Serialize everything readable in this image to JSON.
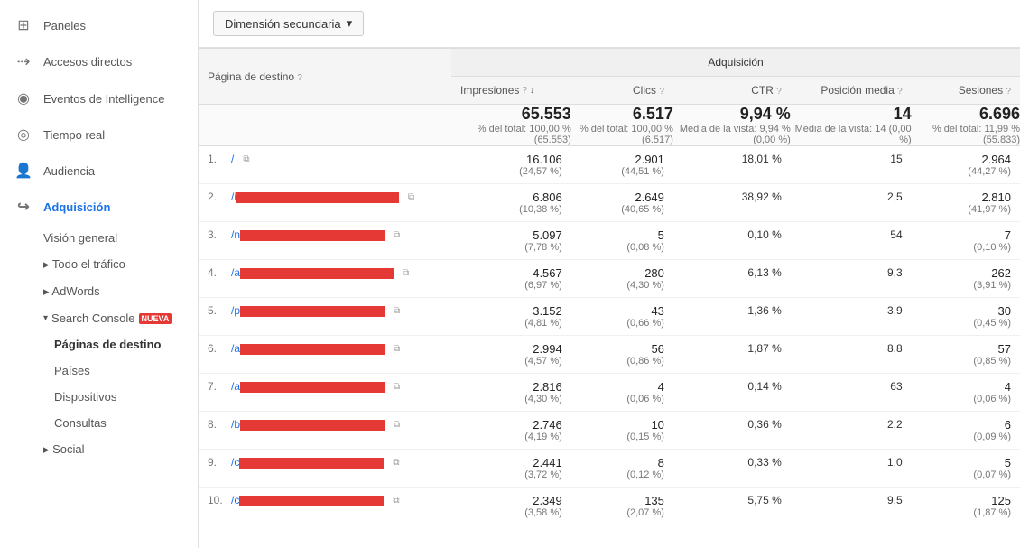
{
  "sidebar": {
    "items": [
      {
        "id": "paneles",
        "label": "Paneles",
        "icon": "⊞"
      },
      {
        "id": "accesos-directos",
        "label": "Accesos directos",
        "icon": "→"
      },
      {
        "id": "eventos-intelligence",
        "label": "Eventos de Intelligence",
        "icon": "○"
      },
      {
        "id": "tiempo-real",
        "label": "Tiempo real",
        "icon": "○"
      },
      {
        "id": "audiencia",
        "label": "Audiencia",
        "icon": "👤"
      },
      {
        "id": "adquisicion",
        "label": "Adquisición",
        "icon": "→",
        "active": true
      }
    ],
    "adquisicion_sub": [
      {
        "id": "vision-general",
        "label": "Visión general"
      },
      {
        "id": "todo-trafico",
        "label": "▸ Todo el tráfico",
        "arrow": true
      },
      {
        "id": "adwords",
        "label": "▸ AdWords",
        "arrow": true
      },
      {
        "id": "search-console",
        "label": "Search Console",
        "nueva": "NUEVA",
        "expanded": true
      },
      {
        "id": "paginas-destino",
        "label": "Páginas de destino",
        "active": true,
        "bold": true
      },
      {
        "id": "paises",
        "label": "Países"
      },
      {
        "id": "dispositivos",
        "label": "Dispositivos"
      },
      {
        "id": "consultas",
        "label": "Consultas"
      },
      {
        "id": "social",
        "label": "▸ Social",
        "arrow": true
      }
    ]
  },
  "toolbar": {
    "secondary_dimension_label": "Dimensión secundaria",
    "dropdown_icon": "▾"
  },
  "table": {
    "columns": {
      "page": {
        "label": "Página de destino",
        "help": "?"
      },
      "adquisicion_group": "Adquisición",
      "impresiones": {
        "label": "Impresiones",
        "help": "?",
        "sorted": true
      },
      "clics": {
        "label": "Clics",
        "help": "?"
      },
      "ctr": {
        "label": "CTR",
        "help": "?"
      },
      "posicion_media": {
        "label": "Posición media",
        "help": "?"
      },
      "sesiones": {
        "label": "Sesiones",
        "help": "?"
      }
    },
    "totals": {
      "impresiones": "65.553",
      "impresiones_sub": "% del total: 100,00 % (65.553)",
      "clics": "6.517",
      "clics_sub": "% del total: 100,00 % (6.517)",
      "ctr": "9,94 %",
      "ctr_sub": "Media de la vista: 9,94 % (0,00 %)",
      "posicion_media": "14",
      "posicion_media_sub": "Media de la vista: 14 (0,00 %)",
      "sesiones": "6.696",
      "sesiones_sub": "% del total: 11,99 % (55.833)"
    },
    "rows": [
      {
        "num": "1.",
        "page": "/",
        "redacted": false,
        "impresiones": "16.106",
        "impresiones_pct": "(24,57 %)",
        "clics": "2.901",
        "clics_pct": "(44,51 %)",
        "ctr": "18,01 %",
        "posicion": "15",
        "sesiones": "2.964",
        "sesiones_pct": "(44,27 %)"
      },
      {
        "num": "2.",
        "page": "/i",
        "redacted": true,
        "impresiones": "6.806",
        "impresiones_pct": "(10,38 %)",
        "clics": "2.649",
        "clics_pct": "(40,65 %)",
        "ctr": "38,92 %",
        "posicion": "2,5",
        "sesiones": "2.810",
        "sesiones_pct": "(41,97 %)"
      },
      {
        "num": "3.",
        "page": "/n",
        "redacted": true,
        "impresiones": "5.097",
        "impresiones_pct": "(7,78 %)",
        "clics": "5",
        "clics_pct": "(0,08 %)",
        "ctr": "0,10 %",
        "posicion": "54",
        "sesiones": "7",
        "sesiones_pct": "(0,10 %)"
      },
      {
        "num": "4.",
        "page": "/a",
        "redacted": true,
        "impresiones": "4.567",
        "impresiones_pct": "(6,97 %)",
        "clics": "280",
        "clics_pct": "(4,30 %)",
        "ctr": "6,13 %",
        "posicion": "9,3",
        "sesiones": "262",
        "sesiones_pct": "(3,91 %)"
      },
      {
        "num": "5.",
        "page": "/p",
        "redacted": true,
        "impresiones": "3.152",
        "impresiones_pct": "(4,81 %)",
        "clics": "43",
        "clics_pct": "(0,66 %)",
        "ctr": "1,36 %",
        "posicion": "3,9",
        "sesiones": "30",
        "sesiones_pct": "(0,45 %)"
      },
      {
        "num": "6.",
        "page": "/a",
        "redacted": true,
        "impresiones": "2.994",
        "impresiones_pct": "(4,57 %)",
        "clics": "56",
        "clics_pct": "(0,86 %)",
        "ctr": "1,87 %",
        "posicion": "8,8",
        "sesiones": "57",
        "sesiones_pct": "(0,85 %)"
      },
      {
        "num": "7.",
        "page": "/a",
        "redacted": true,
        "impresiones": "2.816",
        "impresiones_pct": "(4,30 %)",
        "clics": "4",
        "clics_pct": "(0,06 %)",
        "ctr": "0,14 %",
        "posicion": "63",
        "sesiones": "4",
        "sesiones_pct": "(0,06 %)"
      },
      {
        "num": "8.",
        "page": "/b",
        "redacted": true,
        "impresiones": "2.746",
        "impresiones_pct": "(4,19 %)",
        "clics": "10",
        "clics_pct": "(0,15 %)",
        "ctr": "0,36 %",
        "posicion": "2,2",
        "sesiones": "6",
        "sesiones_pct": "(0,09 %)"
      },
      {
        "num": "9.",
        "page": "/c",
        "redacted": true,
        "impresiones": "2.441",
        "impresiones_pct": "(3,72 %)",
        "clics": "8",
        "clics_pct": "(0,12 %)",
        "ctr": "0,33 %",
        "posicion": "1,0",
        "sesiones": "5",
        "sesiones_pct": "(0,07 %)"
      },
      {
        "num": "10.",
        "page": "/c",
        "redacted": true,
        "impresiones": "2.349",
        "impresiones_pct": "(3,58 %)",
        "clics": "135",
        "clics_pct": "(2,07 %)",
        "ctr": "5,75 %",
        "posicion": "9,5",
        "sesiones": "125",
        "sesiones_pct": "(1,87 %)"
      }
    ]
  }
}
